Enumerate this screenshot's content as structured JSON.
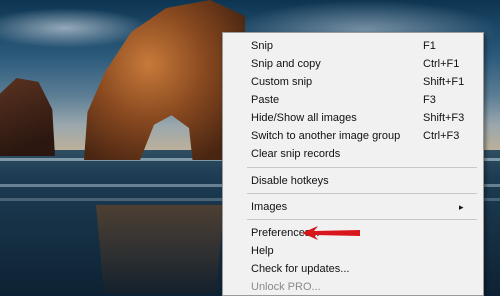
{
  "context_menu": {
    "items": [
      {
        "label": "Snip",
        "shortcut": "F1"
      },
      {
        "label": "Snip and copy",
        "shortcut": "Ctrl+F1"
      },
      {
        "label": "Custom snip",
        "shortcut": "Shift+F1"
      },
      {
        "label": "Paste",
        "shortcut": "F3"
      },
      {
        "label": "Hide/Show all images",
        "shortcut": "Shift+F3"
      },
      {
        "label": "Switch to another image group",
        "shortcut": "Ctrl+F3"
      },
      {
        "label": "Clear snip records",
        "shortcut": ""
      },
      {
        "label": "Disable hotkeys",
        "shortcut": ""
      },
      {
        "label": "Images",
        "shortcut": ""
      },
      {
        "label": "Preferences...",
        "shortcut": ""
      },
      {
        "label": "Help",
        "shortcut": ""
      },
      {
        "label": "Check for updates...",
        "shortcut": ""
      },
      {
        "label": "Unlock PRO...",
        "shortcut": ""
      }
    ],
    "submenu_arrow": "▸"
  },
  "colors": {
    "menu_background": "#f1f1f1",
    "menu_text": "#111111",
    "disabled_text": "#8a8a8a",
    "annotation_arrow": "#d9161c"
  }
}
